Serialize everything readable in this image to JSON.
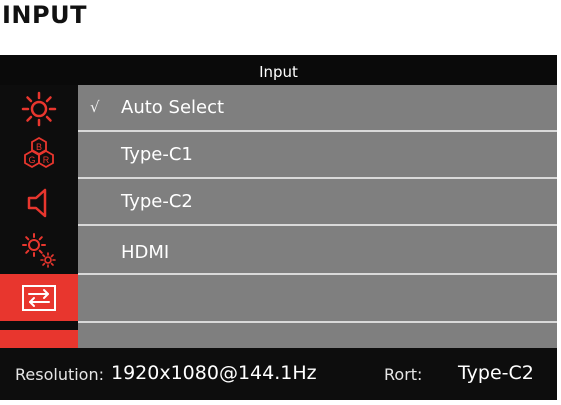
{
  "page": {
    "heading": "INPUT"
  },
  "osd": {
    "title": "Input",
    "sidebar": [
      {
        "name": "brightness-icon",
        "active": false
      },
      {
        "name": "color-rgb-icon",
        "active": false
      },
      {
        "name": "volume-icon",
        "active": false
      },
      {
        "name": "settings-gear-icon",
        "active": false
      },
      {
        "name": "input-source-icon",
        "active": true
      }
    ],
    "options": [
      {
        "label": "Auto Select",
        "checked": true,
        "check_glyph": "√"
      },
      {
        "label": "Type-C1",
        "checked": false
      },
      {
        "label": "Type-C2",
        "checked": false
      },
      {
        "label": "HDMI",
        "checked": false
      },
      {
        "label": "",
        "checked": false
      }
    ],
    "status": {
      "resolution_label": "Resolution:",
      "resolution_value": "1920x1080@144.1Hz",
      "port_label": "Rort:",
      "port_value": "Type-C2"
    },
    "colors": {
      "accent": "#e8362e",
      "panel": "#7f7f7f",
      "bar": "#0d0d0d"
    },
    "rgb_icon_letters": [
      "B",
      "G",
      "R"
    ]
  }
}
